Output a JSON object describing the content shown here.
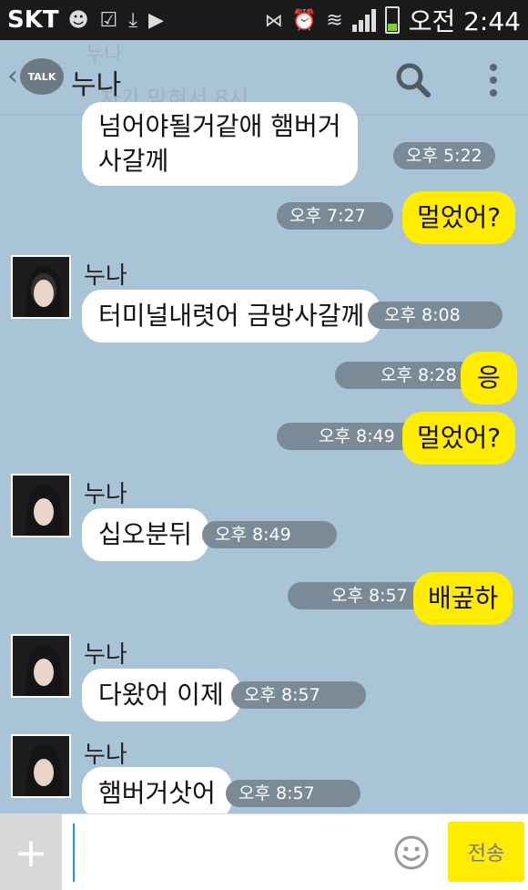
{
  "status_bar": {
    "carrier": "SKT",
    "time": "오전 2:44"
  },
  "header": {
    "back_icon": "chevron-left-icon",
    "badge": "TALK",
    "title": "누나",
    "ghost_name": "누나",
    "ghost_text": "차가 막혀서 8시"
  },
  "messages": [
    {
      "direction": "in",
      "continued": true,
      "lines": [
        "넘어야될거같애 햄버거",
        "사갈께"
      ],
      "time": "오후 5:22"
    },
    {
      "direction": "out",
      "text": "멀었어?",
      "time": "오후 7:27"
    },
    {
      "direction": "in",
      "sender": "누나",
      "text": "터미널내렷어 금방사갈께",
      "time": "오후 8:08"
    },
    {
      "direction": "out",
      "text": "응",
      "time": "오후 8:28"
    },
    {
      "direction": "out",
      "text": "멀었어?",
      "time": "오후 8:49"
    },
    {
      "direction": "in",
      "sender": "누나",
      "text": "십오분뒤",
      "time": "오후 8:49"
    },
    {
      "direction": "out",
      "text": "배곺하",
      "time": "오후 8:57"
    },
    {
      "direction": "in",
      "sender": "누나",
      "text": "다왔어 이제",
      "time": "오후 8:57"
    },
    {
      "direction": "in",
      "sender": "누나",
      "text": "햄버거삿어",
      "time": "오후 8:57"
    }
  ],
  "input_bar": {
    "plus": "+",
    "placeholder": "",
    "send_label": "전송"
  },
  "colors": {
    "background": "#a9c4d6",
    "outgoing": "#ffec00",
    "incoming": "#ffffff",
    "time_pill": "#7a8b97"
  }
}
